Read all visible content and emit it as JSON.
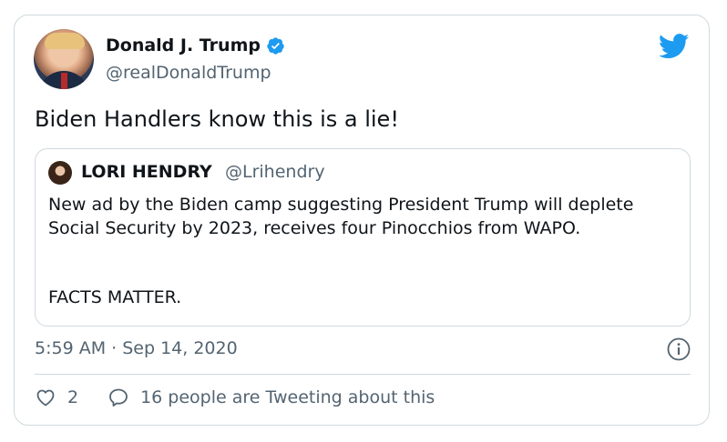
{
  "tweet": {
    "author_name": "Donald J. Trump",
    "author_handle": "@realDonaldTrump",
    "text": "Biden Handlers know this is a lie!",
    "timestamp": "5:59 AM · Sep 14, 2020",
    "like_count": "2",
    "retweet_text": "16 people are Tweeting about this"
  },
  "quoted": {
    "author_name": "LORI HENDRY",
    "author_handle": "@Lrihendry",
    "body": "New ad by the Biden camp suggesting President Trump will deplete Social Security by 2023, receives four Pinocchios from WAPO.",
    "footer": "FACTS MATTER."
  },
  "icons": {
    "verified": "verified-badge-icon",
    "brand": "twitter-bird-icon",
    "info": "info-icon",
    "like": "heart-icon",
    "reply": "speech-bubble-icon"
  },
  "colors": {
    "accent": "#1d9bf0",
    "text": "#0f1419",
    "muted": "#536471",
    "border": "#cfd9de"
  }
}
